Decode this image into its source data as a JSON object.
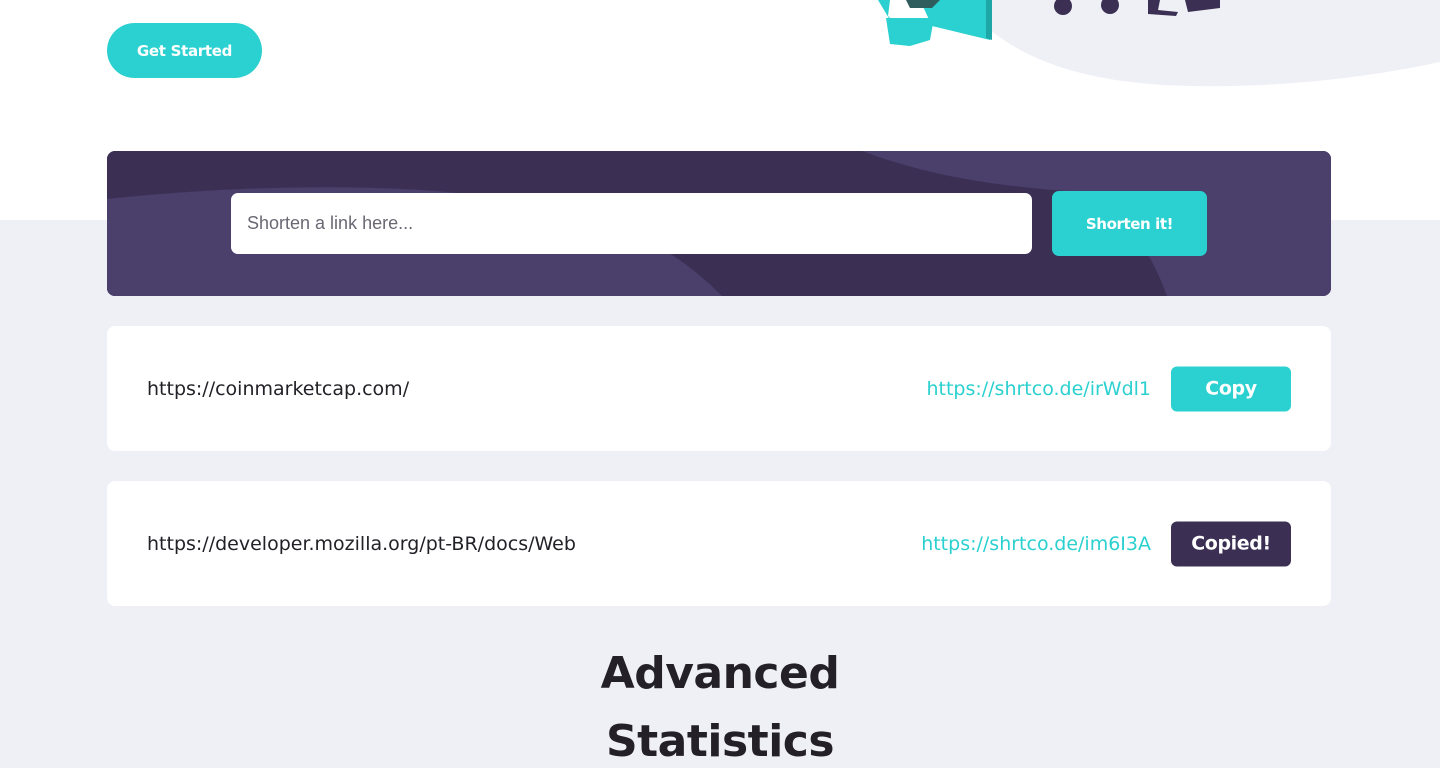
{
  "hero": {
    "cta_label": "Get Started"
  },
  "shorten": {
    "placeholder": "Shorten a link here...",
    "button_label": "Shorten it!"
  },
  "results": [
    {
      "original": "https://coinmarketcap.com/",
      "short": "https://shrtco.de/irWdl1",
      "button_label": "Copy",
      "copied": false
    },
    {
      "original": "https://developer.mozilla.org/pt-BR/docs/Web",
      "short": "https://shrtco.de/im6I3A",
      "button_label": "Copied!",
      "copied": true
    }
  ],
  "statistics": {
    "title_line1": "Advanced",
    "title_line2": "Statistics"
  },
  "colors": {
    "cyan": "#2bd0d0",
    "dark_violet": "#3b3054",
    "gray_bg": "#eff0f6",
    "text_dark": "#232127"
  }
}
